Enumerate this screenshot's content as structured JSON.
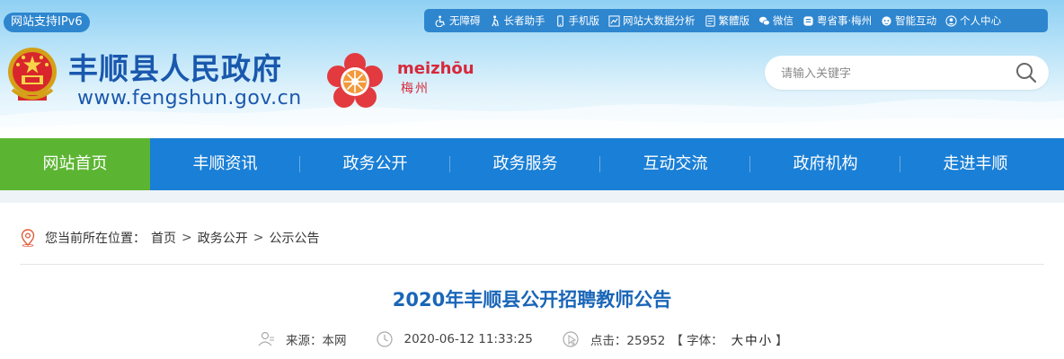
{
  "header": {
    "ipv6_badge": "网站支持IPv6",
    "site_name": "丰顺县人民政府",
    "site_url": "www.fengshun.gov.cn",
    "city_logo_text": "meizhōu",
    "city_logo_cn": "梅州",
    "brand_blue": "#1a58ad",
    "brand_red": "#d7283a"
  },
  "topbar": {
    "items": [
      {
        "label": "无障碍",
        "icon": "wheelchair-icon"
      },
      {
        "label": "长者助手",
        "icon": "elder-icon"
      },
      {
        "label": "手机版",
        "icon": "mobile-icon"
      },
      {
        "label": "网站大数据分析",
        "icon": "chart-icon"
      },
      {
        "label": "繁體版",
        "icon": "document-icon"
      },
      {
        "label": "微信",
        "icon": "wechat-icon"
      },
      {
        "label": "粤省事·梅州",
        "icon": "app-icon"
      },
      {
        "label": "智能互动",
        "icon": "robot-icon"
      },
      {
        "label": "个人中心",
        "icon": "user-icon"
      }
    ]
  },
  "search": {
    "placeholder": "请输入关键字",
    "icon": "search-icon"
  },
  "nav": {
    "items": [
      {
        "label": "网站首页",
        "active": true
      },
      {
        "label": "丰顺资讯"
      },
      {
        "label": "政务公开"
      },
      {
        "label": "政务服务"
      },
      {
        "label": "互动交流"
      },
      {
        "label": "政府机构"
      },
      {
        "label": "走进丰顺"
      }
    ],
    "active_color": "#5cb532",
    "bg_color": "#1a7fd6"
  },
  "breadcrumb": {
    "prefix": "您当前所在位置：",
    "items": [
      "首页",
      "政务公开",
      "公示公告"
    ],
    "separator": ">"
  },
  "article": {
    "title": "2020年丰顺县公开招聘教师公告",
    "source_label": "来源：本网",
    "datetime": "2020-06-12 11:33:25",
    "clicks_label": "点击：25952",
    "font_open": "【 字体：",
    "font_large": "大",
    "font_medium": "中",
    "font_small": "小",
    "font_close": "】"
  }
}
